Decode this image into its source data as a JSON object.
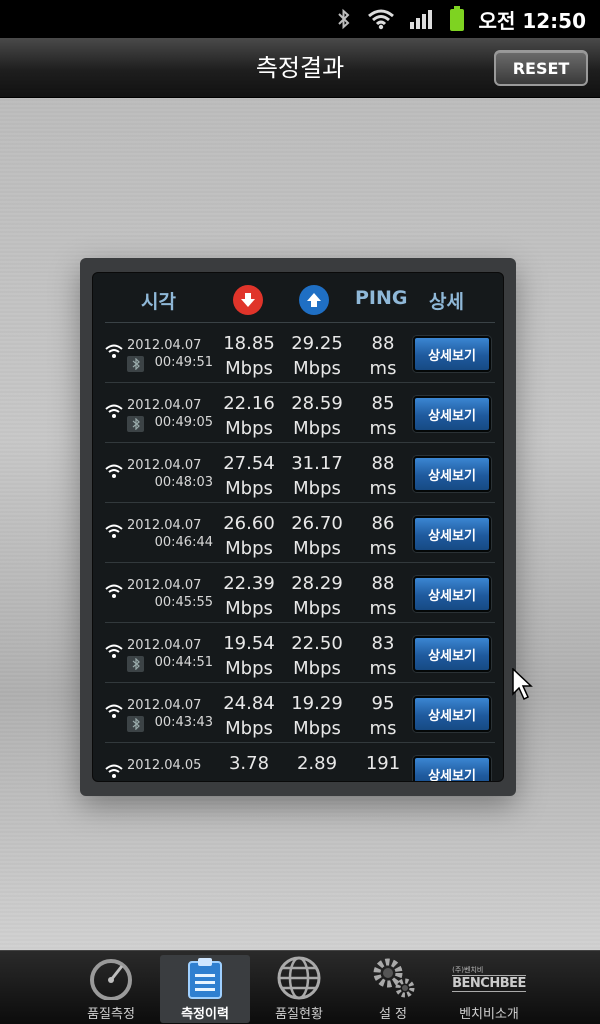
{
  "status_bar": {
    "ampm": "오전",
    "time": "12:50"
  },
  "header": {
    "title": "측정결과",
    "reset_label": "RESET"
  },
  "table": {
    "headers": {
      "time": "시각",
      "ping": "PING",
      "detail": "상세"
    },
    "rows": [
      {
        "date": "2012.04.07",
        "time": "00:49:51",
        "bt": true,
        "download": "18.85",
        "upload": "29.25",
        "ping": "88",
        "unit_speed": "Mbps",
        "unit_ping": "ms",
        "button": "상세보기"
      },
      {
        "date": "2012.04.07",
        "time": "00:49:05",
        "bt": true,
        "download": "22.16",
        "upload": "28.59",
        "ping": "85",
        "unit_speed": "Mbps",
        "unit_ping": "ms",
        "button": "상세보기"
      },
      {
        "date": "2012.04.07",
        "time": "00:48:03",
        "bt": false,
        "download": "27.54",
        "upload": "31.17",
        "ping": "88",
        "unit_speed": "Mbps",
        "unit_ping": "ms",
        "button": "상세보기"
      },
      {
        "date": "2012.04.07",
        "time": "00:46:44",
        "bt": false,
        "download": "26.60",
        "upload": "26.70",
        "ping": "86",
        "unit_speed": "Mbps",
        "unit_ping": "ms",
        "button": "상세보기"
      },
      {
        "date": "2012.04.07",
        "time": "00:45:55",
        "bt": false,
        "download": "22.39",
        "upload": "28.29",
        "ping": "88",
        "unit_speed": "Mbps",
        "unit_ping": "ms",
        "button": "상세보기"
      },
      {
        "date": "2012.04.07",
        "time": "00:44:51",
        "bt": true,
        "download": "19.54",
        "upload": "22.50",
        "ping": "83",
        "unit_speed": "Mbps",
        "unit_ping": "ms",
        "button": "상세보기"
      },
      {
        "date": "2012.04.07",
        "time": "00:43:43",
        "bt": true,
        "download": "24.84",
        "upload": "19.29",
        "ping": "95",
        "unit_speed": "Mbps",
        "unit_ping": "ms",
        "button": "상세보기"
      },
      {
        "date": "2012.04.05",
        "time": "",
        "bt": false,
        "download": "3.78",
        "upload": "2.89",
        "ping": "191",
        "unit_speed": "",
        "unit_ping": "",
        "button": "상세보기"
      }
    ]
  },
  "bottom_nav": {
    "items": [
      {
        "label": "품질측정",
        "icon": "speedometer-icon",
        "active": false
      },
      {
        "label": "측정이력",
        "icon": "clipboard-icon",
        "active": true
      },
      {
        "label": "품질현황",
        "icon": "globe-icon",
        "active": false
      },
      {
        "label": "설 정",
        "icon": "gears-icon",
        "active": false
      },
      {
        "label": "벤치비소개",
        "icon": "benchbee-logo",
        "active": false,
        "logo_text": "BENCHBEE",
        "logo_small": "(주)벤치비"
      }
    ]
  },
  "colors": {
    "accent_header": "#8fb8d8",
    "download": "#e0342a",
    "upload": "#1f6fc4",
    "button": "#1f5a9e"
  }
}
